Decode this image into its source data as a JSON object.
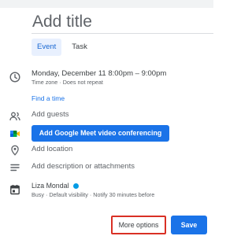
{
  "title_placeholder": "Add title",
  "tabs": [
    {
      "label": "Event",
      "active": true
    },
    {
      "label": "Task",
      "active": false
    }
  ],
  "datetime": {
    "line": "Monday, December 11   8:00pm  –  9:00pm",
    "timezone": "Time zone",
    "repeat": "Does not repeat"
  },
  "find_time_label": "Find a time",
  "guests_placeholder": "Add guests",
  "meet_button_label": "Add Google Meet video conferencing",
  "location_placeholder": "Add location",
  "description_placeholder": "Add description or attachments",
  "calendar": {
    "owner": "Liza Mondal",
    "details": "Busy · Default visibility · Notify 30 minutes before",
    "color": "#039be5"
  },
  "footer": {
    "more_options_label": "More options",
    "save_label": "Save"
  },
  "colors": {
    "accent": "#1a73e8",
    "highlight_border": "#d93025"
  }
}
